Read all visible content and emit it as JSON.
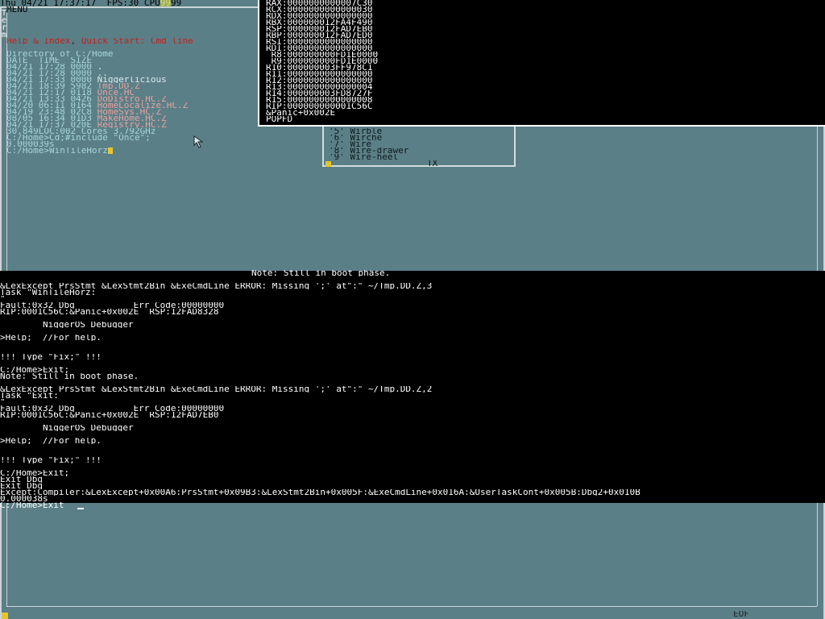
{
  "status_bar": {
    "datetime": "Thu 04/21 17:37:17",
    "fps": "FPS:30",
    "cpu_label": "CPU",
    "cpu_value": "99",
    "cpu_tail": "99"
  },
  "window": {
    "menu_label": "MENU",
    "vertical_title": [
      "T",
      "e",
      "r",
      "m"
    ]
  },
  "help_links": {
    "help_index": "Help & Index",
    "separator": ", ",
    "quick_start": "Quick Start: Cmd line"
  },
  "directory": {
    "header": "Directory of C:/Home",
    "columns": "DATE_ TIME_ SIZE",
    "rows": [
      {
        "date": "04/21",
        "time": "17:28",
        "size": "0000",
        "name": "."
      },
      {
        "date": "04/21",
        "time": "17:28",
        "size": "0000",
        "name": ".."
      },
      {
        "date": "04/21",
        "time": "17:33",
        "size": "0000",
        "name": "Niggerlicious"
      },
      {
        "date": "04/21",
        "time": "18:39",
        "size": "5982",
        "name": "Tmp.DD.Z"
      },
      {
        "date": "04/21",
        "time": "12:17",
        "size": "0118",
        "name": "Once.HC"
      },
      {
        "date": "04/21",
        "time": "13:33",
        "size": "0426",
        "name": "DoDistro.HC.Z"
      },
      {
        "date": "04/20",
        "time": "06:11",
        "size": "0164",
        "name": "HomeLocalize.HC.Z"
      },
      {
        "date": "04/19",
        "time": "23:48",
        "size": "02C8",
        "name": "HomeSys.HC.Z"
      },
      {
        "date": "08/05",
        "time": "16:34",
        "size": "01D3",
        "name": "MakeHome.HC.Z"
      },
      {
        "date": "04/21",
        "time": "17:37",
        "size": "020E",
        "name": "Registry.HC.Z"
      }
    ]
  },
  "shell": {
    "loc_line": "30,849LOC:002 Cores 3.792GHz",
    "include_cmd": "C:/Home>Cd;#include \"Once\";",
    "time_line": "0.000039s",
    "current_cmd": "C:/Home>WinTileHorz"
  },
  "registers": [
    "RAX:0000000000007C30",
    "RCX:0000000000000030",
    "RDX:0000000000000000",
    "RBX:000000012FA4F490",
    "RSP:000000012FAD7EB0",
    "RBP:000000012FAD7ED0",
    "RSI:0000000000000000",
    "RDI:0000000000000000",
    " R8:000000000FD1E0000",
    " R9:000000000FD1E0000",
    "R10:000000003FF978C1",
    "R11:0000000000000000",
    "R12:0000000000000000",
    "R13:0000000000000004",
    "R14:000000003FD8727F",
    "R15:0000000000000008",
    "RIP:000000000001C56C",
    "&Panic+0x002E",
    "POPFD"
  ],
  "tx_menu": {
    "items": [
      "'5' Wirble",
      "'6' Wirche",
      "'7' Wire",
      "'8' Wire-drawer",
      "'9' Wire-heel"
    ],
    "title": "TX"
  },
  "output": {
    "boot_note": "Note: Still in boot phase.",
    "lines": [
      "&LexExcept PrsStmt &LexStmt2Bin &ExeCmdLine ERROR: Missing ';' at\":\" ~/Tmp.DD.Z,3",
      "Task \"WinTileHorz:",
      "\"",
      "Fault:0x32 Dbg           Err Code:00000000",
      "RIP:0001C56C:&Panic+0x002E  RSP:12FAD8328",
      "",
      "        NiggerOS Debugger",
      "",
      ">Help;  //For help.",
      "",
      "",
      "!!! Type \"Fix;\" !!!",
      "",
      "C:/Home>Exit;",
      "Note: Still in boot phase.",
      "",
      "&LexExcept PrsStmt &LexStmt2Bin &ExeCmdLine ERROR: Missing ';' at\":\" ~/Tmp.DD.Z,2",
      "Task \"Exit:",
      "\"",
      "Fault:0x32 Dbg           Err Code:00000000",
      "RIP:0001C56C:&Panic+0x002E  RSP:12FAD7EB0",
      "",
      "        NiggerOS Debugger",
      "",
      ">Help;  //For help.",
      "",
      "",
      "!!! Type \"Fix;\" !!!",
      "",
      "C:/Home>Exit;",
      "Exit Dbg",
      "Exit Dbg",
      "Except:Compiler:&LexExcept+0x00A6:PrsStmt+0x09B3:&LexStmt2Bin+0x005F:&ExeCmdLine+0x016A:&UserTaskCont+0x005B:Dbg2+0x010B",
      "0.000038s"
    ],
    "current_input": "C:/Home>Exit"
  },
  "footer": {
    "eof_label": "EOF"
  }
}
